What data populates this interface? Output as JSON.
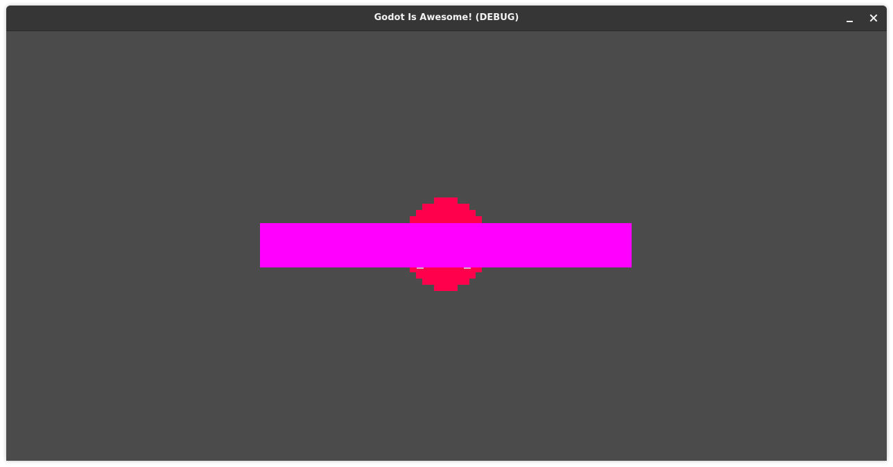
{
  "window": {
    "title": "Godot Is Awesome! (DEBUG)"
  },
  "controls": {
    "minimize_icon": "minimize-icon",
    "close_icon": "close-icon"
  },
  "scene": {
    "background_color": "#4b4b4b",
    "sprite_color": "#ff004d",
    "sprite_eye_color": "#d8b4c8",
    "platform_color": "#ff00ff"
  }
}
